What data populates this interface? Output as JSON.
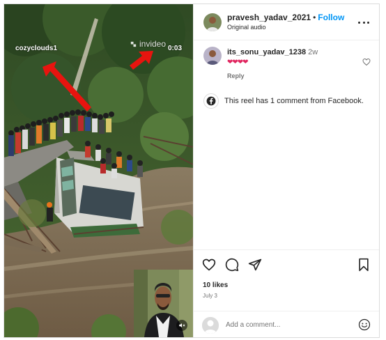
{
  "post": {
    "username": "pravesh_yadav_2021",
    "follow_label": "Follow",
    "audio_label": "Original audio"
  },
  "video": {
    "watermark_handle": "cozyclouds1",
    "watermark_brand": "invideo",
    "timestamp": "0:03"
  },
  "comment": {
    "username": "its_sonu_yadav_1238",
    "time": "2w",
    "text": "❤❤❤❤",
    "reply_label": "Reply"
  },
  "facebook_note": "This reel has 1 comment from Facebook.",
  "likes": "10 likes",
  "date": "July 3",
  "add_comment": {
    "placeholder": "Add a comment..."
  },
  "colors": {
    "follow_blue": "#0095f6",
    "heart_red": "#e0245e",
    "arrow_red": "#e8140f"
  },
  "icons": [
    "more-options-icon",
    "like-heart-icon",
    "comment-icon",
    "share-icon",
    "save-bookmark-icon",
    "facebook-icon",
    "emoji-icon",
    "mute-icon"
  ]
}
